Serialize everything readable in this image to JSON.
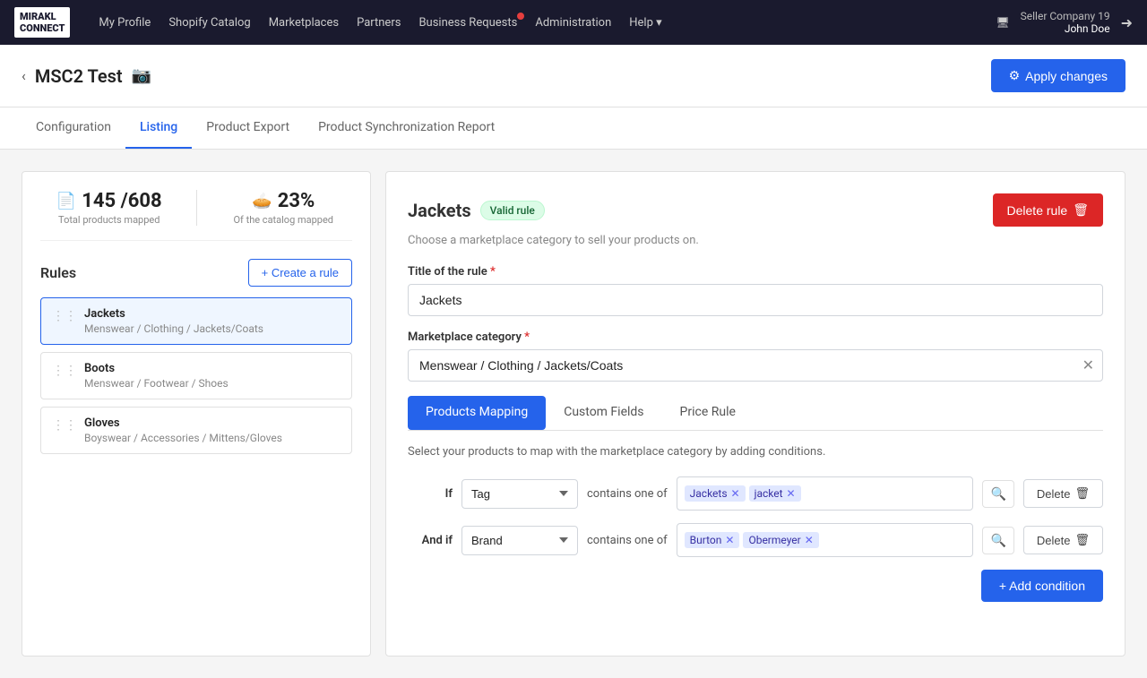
{
  "nav": {
    "logo_line1": "MIRAKL",
    "logo_line2": "CONNECT",
    "links": [
      {
        "label": "My Profile",
        "id": "my-profile"
      },
      {
        "label": "Shopify Catalog",
        "id": "shopify-catalog"
      },
      {
        "label": "Marketplaces",
        "id": "marketplaces",
        "has_dot": false
      },
      {
        "label": "Partners",
        "id": "partners"
      },
      {
        "label": "Business Requests",
        "id": "business-requests",
        "has_dot": true
      },
      {
        "label": "Administration",
        "id": "administration"
      },
      {
        "label": "Help",
        "id": "help",
        "has_dropdown": true
      }
    ],
    "company": "Seller Company 19",
    "username": "John Doe"
  },
  "page": {
    "back_label": "‹",
    "title": "MSC2 Test",
    "camera_icon": "📷",
    "apply_changes_label": "Apply changes",
    "apply_icon": "⚙"
  },
  "tabs": [
    {
      "label": "Configuration",
      "id": "configuration"
    },
    {
      "label": "Listing",
      "id": "listing",
      "active": true
    },
    {
      "label": "Product Export",
      "id": "product-export"
    },
    {
      "label": "Product Synchronization Report",
      "id": "product-sync-report"
    }
  ],
  "left": {
    "stats": {
      "mapped_count": "145 /608",
      "mapped_label": "Total products mapped",
      "catalog_pct": "23%",
      "catalog_label": "Of the catalog mapped"
    },
    "rules_title": "Rules",
    "create_rule_label": "+ Create a rule",
    "rules": [
      {
        "name": "Jackets",
        "path": "Menswear / Clothing / Jackets/Coats",
        "active": true
      },
      {
        "name": "Boots",
        "path": "Menswear / Footwear / Shoes",
        "active": false
      },
      {
        "name": "Gloves",
        "path": "Boyswear / Accessories / Mittens/Gloves",
        "active": false
      }
    ]
  },
  "right": {
    "rule_title": "Jackets",
    "valid_badge": "Valid rule",
    "delete_rule_label": "Delete rule",
    "subtitle": "Choose a marketplace category to sell your products on.",
    "title_label": "Title of the rule",
    "title_value": "Jackets",
    "category_label": "Marketplace category",
    "category_value": "Menswear / Clothing / Jackets/Coats",
    "inner_tabs": [
      {
        "label": "Products Mapping",
        "active": true
      },
      {
        "label": "Custom Fields",
        "active": false
      },
      {
        "label": "Price Rule",
        "active": false
      }
    ],
    "mapping_desc": "Select your products to map with the marketplace category by adding conditions.",
    "conditions": [
      {
        "prefix": "If",
        "field": "Tag",
        "operator": "contains one of",
        "tags": [
          {
            "label": "Jackets"
          },
          {
            "label": "jacket"
          }
        ]
      },
      {
        "prefix": "And if",
        "field": "Brand",
        "operator": "contains one of",
        "tags": [
          {
            "label": "Burton"
          },
          {
            "label": "Obermeyer"
          }
        ]
      }
    ],
    "add_condition_label": "+ Add condition",
    "delete_label": "Delete"
  }
}
